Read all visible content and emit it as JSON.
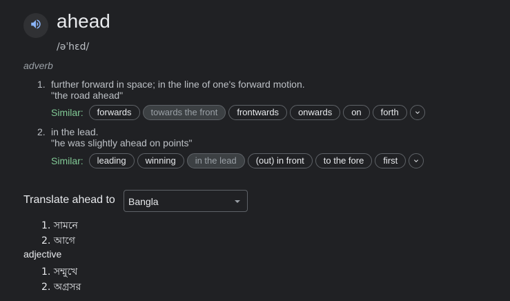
{
  "entry": {
    "word": "ahead",
    "phonetic": "/əˈhɛd/",
    "part_of_speech": "adverb",
    "speaker_icon": "volume-icon"
  },
  "senses": [
    {
      "number": "1.",
      "definition": "further forward in space; in the line of one's forward motion.",
      "example": "\"the road ahead\"",
      "similar_label": "Similar:",
      "similar": [
        "forwards",
        "towards the front",
        "frontwards",
        "onwards",
        "on",
        "forth"
      ],
      "highlighted": "towards the front"
    },
    {
      "number": "2.",
      "definition": "in the lead.",
      "example": "\"he was slightly ahead on points\"",
      "similar_label": "Similar:",
      "similar": [
        "leading",
        "winning",
        "in the lead",
        "(out) in front",
        "to the fore",
        "first"
      ],
      "highlighted": "in the lead"
    }
  ],
  "translate": {
    "label": "Translate ahead to",
    "selected_language": "Bangla",
    "items": [
      {
        "number": "1.",
        "text": "সামনে"
      },
      {
        "number": "2.",
        "text": "আগে"
      }
    ],
    "adjective_label": "adjective",
    "adjective_items": [
      {
        "number": "1.",
        "text": "সম্মুখে"
      },
      {
        "number": "2.",
        "text": "অগ্রসর"
      }
    ]
  },
  "colors": {
    "background": "#202124",
    "similar_label": "#81c995",
    "chip_border": "#5f6368"
  }
}
